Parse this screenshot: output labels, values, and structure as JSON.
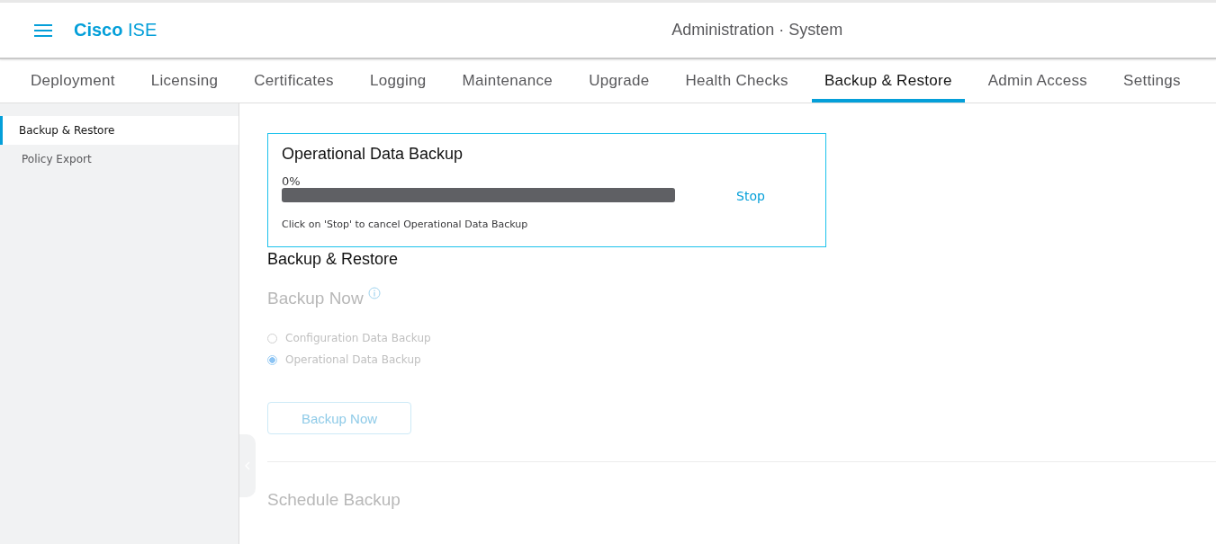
{
  "header": {
    "brand_bold": "Cisco",
    "brand_light": "ISE",
    "title": "Administration · System"
  },
  "tabs": [
    {
      "label": "Deployment",
      "selected": false
    },
    {
      "label": "Licensing",
      "selected": false
    },
    {
      "label": "Certificates",
      "selected": false
    },
    {
      "label": "Logging",
      "selected": false
    },
    {
      "label": "Maintenance",
      "selected": false
    },
    {
      "label": "Upgrade",
      "selected": false
    },
    {
      "label": "Health Checks",
      "selected": false
    },
    {
      "label": "Backup & Restore",
      "selected": true
    },
    {
      "label": "Admin Access",
      "selected": false
    },
    {
      "label": "Settings",
      "selected": false
    }
  ],
  "sidebar": {
    "items": [
      {
        "label": "Backup & Restore",
        "selected": true
      },
      {
        "label": "Policy Export",
        "selected": false
      }
    ]
  },
  "progress_dialog": {
    "title": "Operational Data Backup",
    "percent": "0%",
    "level": 0,
    "stop_link": "Stop",
    "hint": "Click on 'Stop' to cancel Operational Data Backup"
  },
  "content": {
    "heading": "Backup & Restore",
    "section_title": "Backup Now",
    "disabled": true,
    "options": [
      {
        "label": "Configuration Data Backup",
        "selected": false
      },
      {
        "label": "Operational Data Backup",
        "selected": true
      }
    ],
    "button": "Backup Now",
    "schedule_title": "Schedule Backup"
  }
}
